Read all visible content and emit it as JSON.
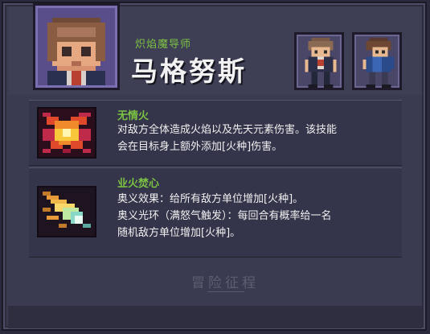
{
  "hero": {
    "class_label": "炽焰魔导师",
    "name": "马格努斯"
  },
  "skills": [
    {
      "name": "无情火",
      "icon": "fire-burst-icon",
      "description": "对敌方全体造成火焰以及先天元素伤害。该技能\n会在目标身上额外添加[火种]伤害。"
    },
    {
      "name": "业火焚心",
      "icon": "comet-icon",
      "description": "奥义效果：给所有敌方单位增加[火种]。\n奥义光环（满怒气触发）：每回合有概率给一名\n随机敌方单位增加[火种]。"
    }
  ],
  "logo": {
    "text": "冒险征程"
  },
  "colors": {
    "accent_green": "#7cc243",
    "panel": "#34344a",
    "portrait_bg": "#5a4e8a",
    "text": "#f0f0f0"
  }
}
